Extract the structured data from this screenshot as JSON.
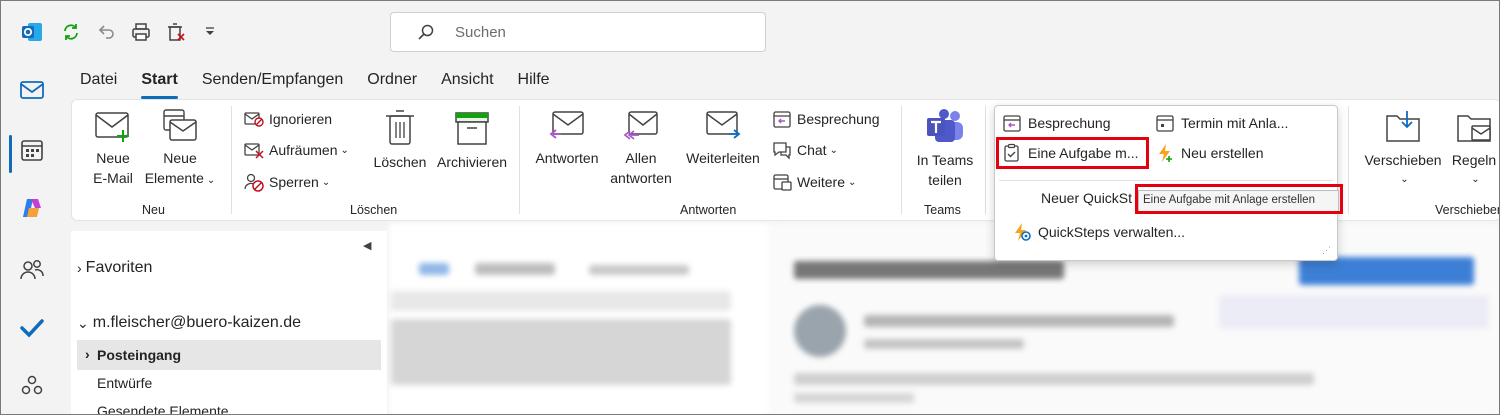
{
  "search": {
    "placeholder": "Suchen"
  },
  "tabs": [
    "Datei",
    "Start",
    "Senden/Empfangen",
    "Ordner",
    "Ansicht",
    "Hilfe"
  ],
  "ribbon": {
    "neu": {
      "label": "Neu",
      "new_email_1": "Neue",
      "new_email_2": "E-Mail",
      "new_items_1": "Neue",
      "new_items_2": "Elemente"
    },
    "loeschen": {
      "label": "Löschen",
      "ignore": "Ignorieren",
      "cleanup": "Aufräumen",
      "block": "Sperren",
      "delete": "Löschen",
      "archive": "Archivieren"
    },
    "antworten": {
      "label": "Antworten",
      "reply": "Antworten",
      "reply_all_1": "Allen",
      "reply_all_2": "antworten",
      "forward": "Weiterleiten",
      "meeting": "Besprechung",
      "chat": "Chat",
      "more": "Weitere"
    },
    "teams": {
      "label": "Teams",
      "share_1": "In Teams",
      "share_2": "teilen"
    },
    "move": {
      "move": "Verschieben",
      "rules": "Regeln",
      "label": "Verschieben"
    }
  },
  "quicksteps": {
    "meeting": "Besprechung",
    "appt_attachment": "Termin mit Anla...",
    "task_attachment": "Eine Aufgabe m...",
    "create_new": "Neu erstellen",
    "new_quickstep": "Neuer QuickSt",
    "manage": "QuickSteps verwalten...",
    "tooltip": "Eine Aufgabe mit Anlage erstellen"
  },
  "folders": {
    "favorites": "Favoriten",
    "account": "m.fleischer@buero-kaizen.de",
    "inbox": "Posteingang",
    "drafts": "Entwürfe",
    "sent": "Gesendete Elemente"
  },
  "colors": {
    "accent": "#0f6cbd",
    "highlight": "#e4000f"
  }
}
